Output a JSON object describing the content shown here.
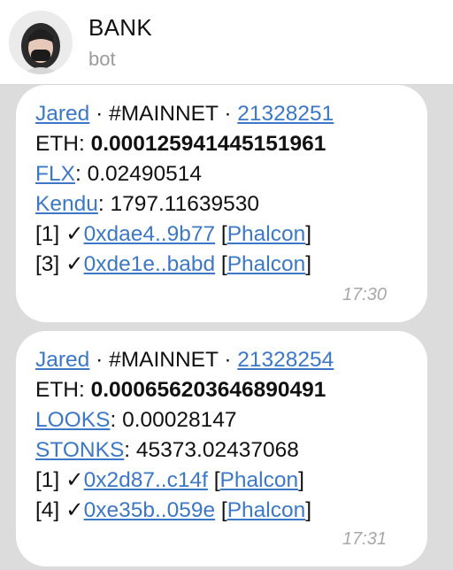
{
  "header": {
    "title": "BANK",
    "subtitle": "bot"
  },
  "messages": [
    {
      "user": "Jared",
      "network": "#MAINNET",
      "block": "21328251",
      "eth_label": "ETH:",
      "eth_value": "0.000125941445151961",
      "token1_name": "FLX",
      "token1_value": "0.02490514",
      "token2_name": "Kendu",
      "token2_value": "1797.11639530",
      "tx1_index": "[1]",
      "tx1_check": "✓",
      "tx1_hash": "0xdae4..9b77",
      "tx1_link": "Phalcon",
      "tx2_index": "[3]",
      "tx2_check": "✓",
      "tx2_hash": "0xde1e..babd",
      "tx2_link": "Phalcon",
      "time": "17:30"
    },
    {
      "user": "Jared",
      "network": "#MAINNET",
      "block": "21328254",
      "eth_label": "ETH:",
      "eth_value": "0.000656203646890491",
      "token1_name": "LOOKS",
      "token1_value": "0.00028147",
      "token2_name": "STONKS",
      "token2_value": "45373.02437068",
      "tx1_index": "[1]",
      "tx1_check": "✓",
      "tx1_hash": "0x2d87..c14f",
      "tx1_link": "Phalcon",
      "tx2_index": "[4]",
      "tx2_check": "✓",
      "tx2_hash": "0xe35b..059e",
      "tx2_link": "Phalcon",
      "time": "17:31"
    }
  ],
  "colors": {
    "link": "#3c78c6",
    "background": "#dcdcdc",
    "bubble": "#ffffff",
    "timestamp": "#a8a8a8"
  }
}
